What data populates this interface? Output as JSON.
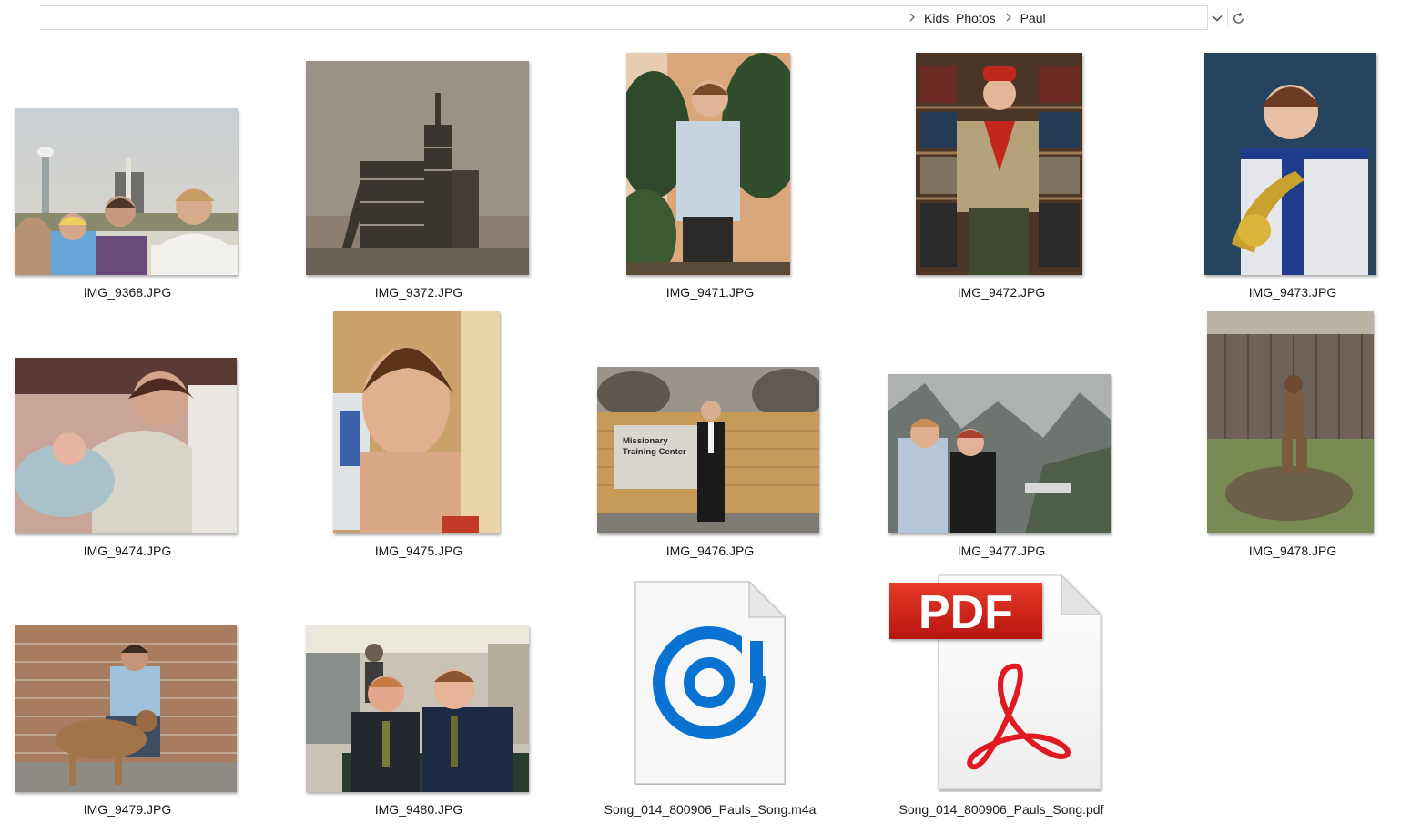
{
  "breadcrumbs": [
    "Kids_Photos",
    "Paul"
  ],
  "icons": {
    "breadcrumb_separator": "chevron-right-icon",
    "address_dropdown": "chevron-down-icon",
    "refresh": "refresh-icon"
  },
  "files": [
    {
      "name": "IMG_9368.JPG",
      "kind": "photo"
    },
    {
      "name": "IMG_9372.JPG",
      "kind": "photo"
    },
    {
      "name": "IMG_9471.JPG",
      "kind": "photo"
    },
    {
      "name": "IMG_9472.JPG",
      "kind": "photo"
    },
    {
      "name": "IMG_9473.JPG",
      "kind": "photo"
    },
    {
      "name": "IMG_9474.JPG",
      "kind": "photo"
    },
    {
      "name": "IMG_9475.JPG",
      "kind": "photo"
    },
    {
      "name": "IMG_9476.JPG",
      "kind": "photo",
      "sign_text": "Missionary Training Center"
    },
    {
      "name": "IMG_9477.JPG",
      "kind": "photo"
    },
    {
      "name": "IMG_9478.JPG",
      "kind": "photo"
    },
    {
      "name": "IMG_9479.JPG",
      "kind": "photo"
    },
    {
      "name": "IMG_9480.JPG",
      "kind": "photo"
    },
    {
      "name": "Song_014_800906_Pauls_Song.m4a",
      "kind": "audio",
      "icon": "groove-music-icon",
      "accent": "#0a73d2"
    },
    {
      "name": "Song_014_800906_Pauls_Song.pdf",
      "kind": "pdf",
      "icon": "pdf-file-icon",
      "badge_text": "PDF",
      "accent": "#d5101c"
    }
  ]
}
